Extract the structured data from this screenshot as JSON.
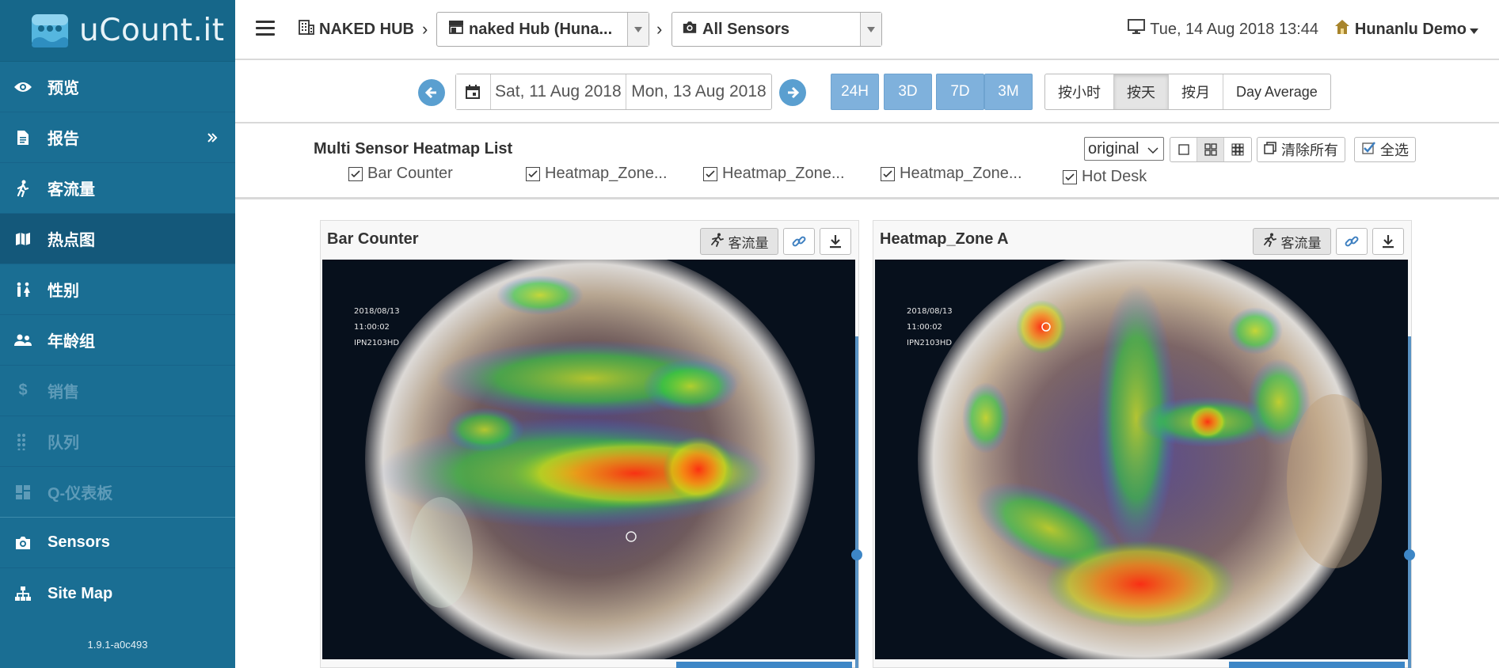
{
  "sidebar": {
    "logo_text": "uCount.it",
    "items": [
      {
        "label": "预览",
        "icon": "eye-icon",
        "state": "normal"
      },
      {
        "label": "报告",
        "icon": "document-icon",
        "state": "normal"
      },
      {
        "label": "客流量",
        "icon": "walking-person-icon",
        "state": "normal"
      },
      {
        "label": "热点图",
        "icon": "map-icon",
        "state": "active"
      },
      {
        "label": "性别",
        "icon": "gender-icon",
        "state": "normal"
      },
      {
        "label": "年龄组",
        "icon": "users-icon",
        "state": "normal"
      },
      {
        "label": "销售",
        "icon": "dollar-icon",
        "state": "disabled"
      },
      {
        "label": "队列",
        "icon": "dots-grid-icon",
        "state": "disabled"
      },
      {
        "label": "Q-仪表板",
        "icon": "dashboard-icon",
        "state": "disabled"
      },
      {
        "label": "Sensors",
        "icon": "camera-icon",
        "state": "normal"
      },
      {
        "label": "Site Map",
        "icon": "sitemap-icon",
        "state": "normal"
      }
    ],
    "version": "1.9.1-a0c493"
  },
  "topbar": {
    "org": "NAKED HUB",
    "site_select": "naked Hub (Huna...",
    "sensor_select": "All Sensors",
    "datetime": "Tue, 14 Aug 2018 13:44",
    "user": "Hunanlu Demo"
  },
  "datebar": {
    "start_date": "Sat, 11 Aug 2018",
    "end_date": "Mon, 13 Aug 2018",
    "ranges": [
      "24H",
      "3D",
      "7D",
      "3M"
    ],
    "granularity": [
      "按小时",
      "按天",
      "按月",
      "Day Average"
    ],
    "active_granularity": "按天"
  },
  "sensor_list": {
    "title": "Multi Sensor Heatmap List",
    "sensors": [
      "Bar Counter",
      "Heatmap_Zone...",
      "Heatmap_Zone...",
      "Heatmap_Zone...",
      "Hot Desk"
    ],
    "view_mode": "original",
    "clear_all": "清除所有",
    "select_all": "全选"
  },
  "panels": [
    {
      "title": "Bar Counter",
      "traffic_label": "客流量",
      "overlay": [
        "2018/08/13",
        "11:00:02",
        "IPN2103HD"
      ]
    },
    {
      "title": "Heatmap_Zone A",
      "traffic_label": "客流量",
      "overlay": [
        "2018/08/13",
        "11:00:02",
        "IPN2103HD"
      ]
    }
  ],
  "colors": {
    "sidebar": "#1a6e93",
    "sidebar_active": "#14587a",
    "range_button": "#7fb1dc",
    "accent": "#3d86c6"
  }
}
